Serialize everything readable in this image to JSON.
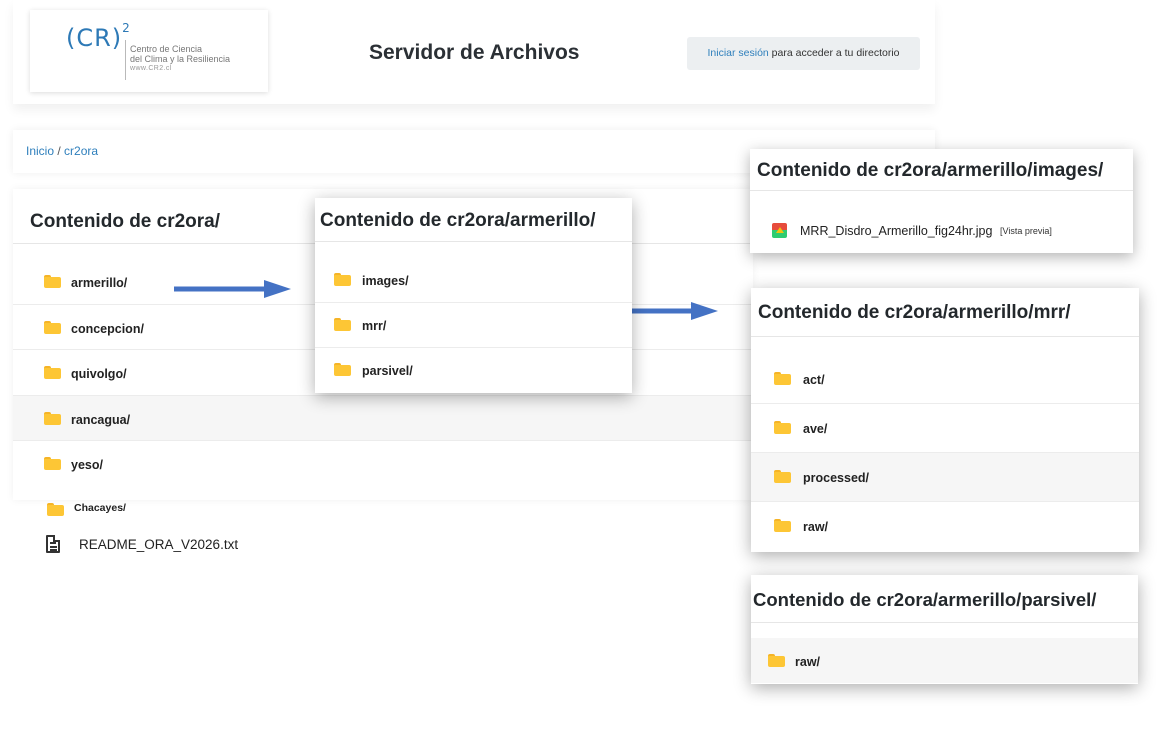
{
  "header": {
    "logo": {
      "mark": "(CR)",
      "mark_sup": "2",
      "line1": "Centro de Ciencia",
      "line2": "del Clima y la Resiliencia",
      "url": "www.CR2.cl"
    },
    "site_title": "Servidor de Archivos",
    "login_link": "Iniciar sesión",
    "login_rest": " para acceder a tu directorio"
  },
  "breadcrumb": {
    "home": "Inicio",
    "separator": " / ",
    "current": "cr2ora"
  },
  "main_panel": {
    "title": "Contenido de cr2ora/",
    "items": [
      "armerillo/",
      "concepcion/",
      "quivolgo/",
      "rancagua/",
      "yeso/"
    ]
  },
  "extra_items": {
    "folder": "Chacayes/",
    "file": "README_ORA_V2026.txt"
  },
  "armerillo_panel": {
    "title": "Contenido de cr2ora/armerillo/",
    "items": [
      "images/",
      "mrr/",
      "parsivel/"
    ]
  },
  "images_panel": {
    "title": "Contenido de cr2ora/armerillo/images/",
    "file": "MRR_Disdro_Armerillo_fig24hr.jpg",
    "preview": "[Vista previa]"
  },
  "mrr_panel": {
    "title": "Contenido de cr2ora/armerillo/mrr/",
    "items": [
      "act/",
      "ave/",
      "processed/",
      "raw/"
    ]
  },
  "parsivel_panel": {
    "title": "Contenido de cr2ora/armerillo/parsivel/",
    "items": [
      "raw/"
    ]
  },
  "colors": {
    "link": "#2e7fbc",
    "folder": "#fdc635",
    "arrow": "#4472c4"
  }
}
